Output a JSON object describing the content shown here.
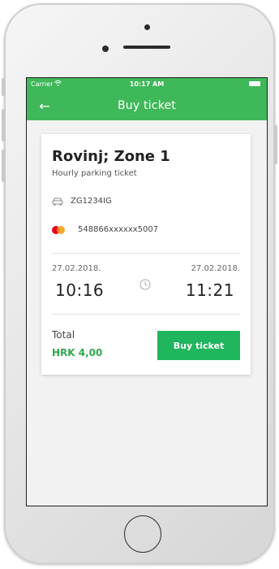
{
  "status_bar": {
    "carrier": "Carrier",
    "time": "10:17 AM",
    "wifi_icon": "wifi-icon",
    "battery_icon": "battery-icon"
  },
  "nav": {
    "back_icon": "arrow-left-icon",
    "back_glyph": "←",
    "title": "Buy ticket"
  },
  "ticket": {
    "zone": "Rovinj; Zone 1",
    "type": "Hourly parking ticket",
    "plate_icon": "car-icon",
    "plate": "ZG1234IG",
    "card_icon": "mastercard-icon",
    "card_number": "548866xxxxxx5007",
    "start_date": "27.02.2018.",
    "start_time": "10:16",
    "end_date": "27.02.2018.",
    "end_time": "11:21",
    "clock_icon": "clock-icon"
  },
  "total": {
    "label": "Total",
    "amount": "HRK 4,00"
  },
  "actions": {
    "buy_label": "Buy ticket"
  },
  "colors": {
    "brand_green": "#3fb859",
    "button_green": "#1fb65d",
    "amount_green": "#2eaa4f"
  }
}
